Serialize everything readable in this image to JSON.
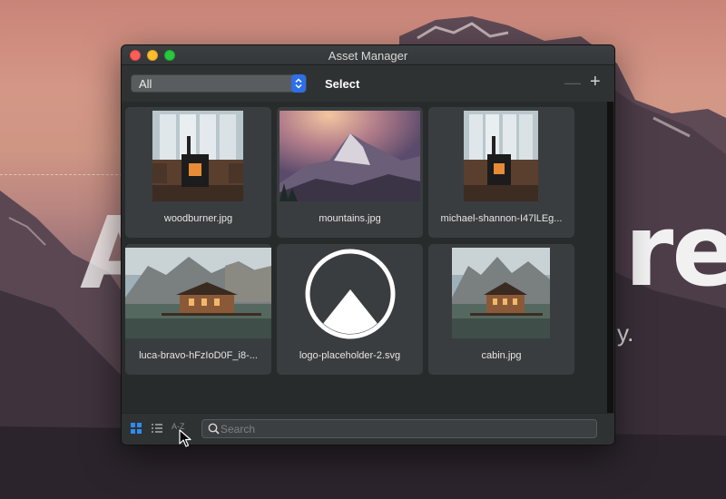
{
  "window": {
    "title": "Asset Manager"
  },
  "toolbar": {
    "filter_value": "All",
    "select_label": "Select",
    "remove_label": "—",
    "add_label": "+"
  },
  "assets": [
    {
      "name": "woodburner.jpg"
    },
    {
      "name": "mountains.jpg"
    },
    {
      "name": "michael-shannon-I47lLEg..."
    },
    {
      "name": "luca-bravo-hFzIoD0F_i8-..."
    },
    {
      "name": "logo-placeholder-2.svg"
    },
    {
      "name": "cabin.jpg"
    }
  ],
  "footer": {
    "sort_label": "A-Z",
    "search_placeholder": "Search"
  },
  "background": {
    "left_text": "A",
    "right_text": "re",
    "small_text": "y."
  },
  "colors": {
    "accent": "#2d6fe6",
    "window_bg": "#2b2e2f",
    "tile_bg": "#3a3d3f"
  }
}
